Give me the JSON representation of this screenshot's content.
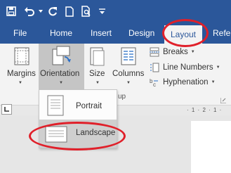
{
  "qat": {
    "icons": [
      "save-icon",
      "undo-icon",
      "redo-icon",
      "new-document-icon",
      "print-preview-icon",
      "customize-icon"
    ]
  },
  "tabs": [
    {
      "label": "File",
      "active": false
    },
    {
      "label": "Home",
      "active": false
    },
    {
      "label": "Insert",
      "active": false
    },
    {
      "label": "Design",
      "active": false
    },
    {
      "label": "Layout",
      "active": true
    },
    {
      "label": "Refe",
      "active": false
    }
  ],
  "ribbon": {
    "margins": "Margins",
    "orientation": "Orientation",
    "size": "Size",
    "columns": "Columns",
    "breaks": "Breaks",
    "line_numbers": "Line Numbers",
    "hyphenation": "Hyphenation",
    "group_label": "up"
  },
  "ruler": {
    "text": "· 1 · 2 · 1 ·"
  },
  "orientation_menu": {
    "portrait": "Portrait",
    "landscape": "Landscape"
  },
  "colors": {
    "brand": "#2b579a",
    "ribbon": "#f3f3f3",
    "annotation": "#e0202a"
  }
}
